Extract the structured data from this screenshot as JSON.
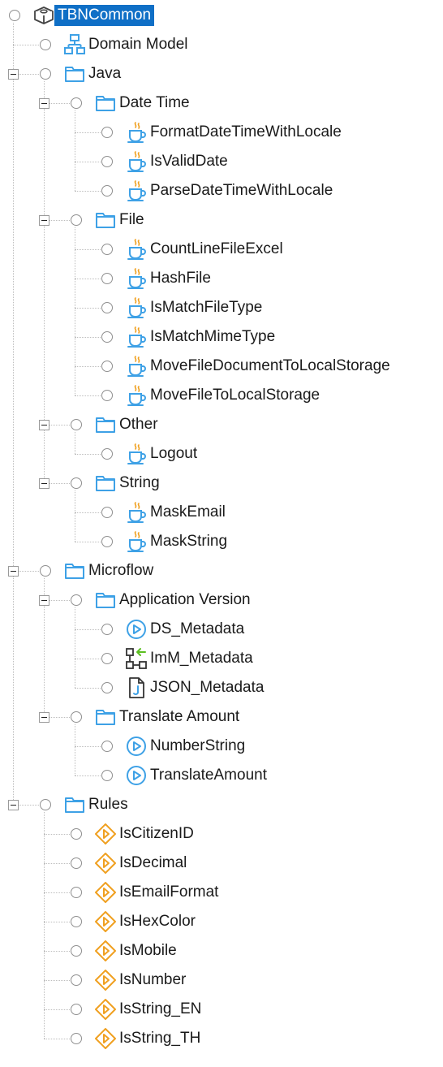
{
  "tree": [
    {
      "label": "TBNCommon",
      "icon": "module-box-icon",
      "depth": 0,
      "selected": true
    },
    {
      "label": "Domain Model",
      "icon": "domain-model-icon",
      "depth": 1
    },
    {
      "label": "Java",
      "icon": "folder-icon",
      "depth": 1,
      "expanded": true
    },
    {
      "label": "Date Time",
      "icon": "folder-icon",
      "depth": 2,
      "expanded": true
    },
    {
      "label": "FormatDateTimeWithLocale",
      "icon": "java-cup-icon",
      "depth": 3
    },
    {
      "label": "IsValidDate",
      "icon": "java-cup-icon",
      "depth": 3
    },
    {
      "label": "ParseDateTimeWithLocale",
      "icon": "java-cup-icon",
      "depth": 3
    },
    {
      "label": "File",
      "icon": "folder-icon",
      "depth": 2,
      "expanded": true
    },
    {
      "label": "CountLineFileExcel",
      "icon": "java-cup-icon",
      "depth": 3
    },
    {
      "label": "HashFile",
      "icon": "java-cup-icon",
      "depth": 3
    },
    {
      "label": "IsMatchFileType",
      "icon": "java-cup-icon",
      "depth": 3
    },
    {
      "label": "IsMatchMimeType",
      "icon": "java-cup-icon",
      "depth": 3
    },
    {
      "label": "MoveFileDocumentToLocalStorage",
      "icon": "java-cup-icon",
      "depth": 3
    },
    {
      "label": "MoveFileToLocalStorage",
      "icon": "java-cup-icon",
      "depth": 3
    },
    {
      "label": "Other",
      "icon": "folder-icon",
      "depth": 2,
      "expanded": true
    },
    {
      "label": "Logout",
      "icon": "java-cup-icon",
      "depth": 3
    },
    {
      "label": "String",
      "icon": "folder-icon",
      "depth": 2,
      "expanded": true
    },
    {
      "label": "MaskEmail",
      "icon": "java-cup-icon",
      "depth": 3
    },
    {
      "label": "MaskString",
      "icon": "java-cup-icon",
      "depth": 3
    },
    {
      "label": "Microflow",
      "icon": "folder-icon",
      "depth": 1,
      "expanded": true
    },
    {
      "label": "Application Version",
      "icon": "folder-icon",
      "depth": 2,
      "expanded": true
    },
    {
      "label": "DS_Metadata",
      "icon": "microflow-play-icon",
      "depth": 3
    },
    {
      "label": "ImM_Metadata",
      "icon": "import-mapping-icon",
      "depth": 3
    },
    {
      "label": "JSON_Metadata",
      "icon": "json-structure-icon",
      "depth": 3
    },
    {
      "label": "Translate Amount",
      "icon": "folder-icon",
      "depth": 2,
      "expanded": true
    },
    {
      "label": "NumberString",
      "icon": "microflow-play-icon",
      "depth": 3
    },
    {
      "label": "TranslateAmount",
      "icon": "microflow-play-icon",
      "depth": 3
    },
    {
      "label": "Rules",
      "icon": "folder-icon",
      "depth": 1,
      "expanded": true
    },
    {
      "label": "IsCitizenID",
      "icon": "rule-diamond-icon",
      "depth": 2
    },
    {
      "label": "IsDecimal",
      "icon": "rule-diamond-icon",
      "depth": 2
    },
    {
      "label": "IsEmailFormat",
      "icon": "rule-diamond-icon",
      "depth": 2
    },
    {
      "label": "IsHexColor",
      "icon": "rule-diamond-icon",
      "depth": 2
    },
    {
      "label": "IsMobile",
      "icon": "rule-diamond-icon",
      "depth": 2
    },
    {
      "label": "IsNumber",
      "icon": "rule-diamond-icon",
      "depth": 2
    },
    {
      "label": "IsString_EN",
      "icon": "rule-diamond-icon",
      "depth": 2
    },
    {
      "label": "IsString_TH",
      "icon": "rule-diamond-icon",
      "depth": 2
    }
  ],
  "colors": {
    "selection": "#0f6fc6",
    "folder": "#3ea1e6",
    "java_steam": "#f0a020",
    "java_cup": "#3ea1e6",
    "microflow": "#3ea1e6",
    "rule": "#f0a020",
    "import_arrow": "#5bbf21"
  }
}
